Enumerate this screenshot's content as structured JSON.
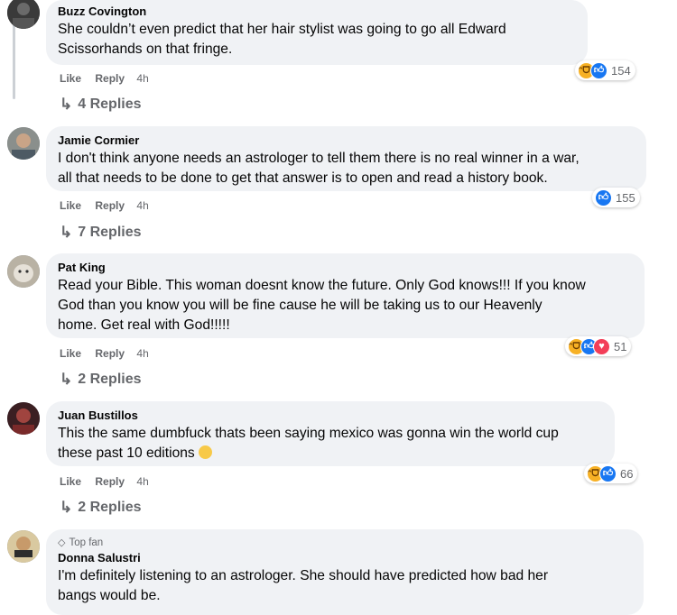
{
  "comments": [
    {
      "author": "Buzz Covington",
      "lines": [
        "She couldn’t even predict that her hair stylist was going to go all Edward",
        "Scissorhands on that fringe."
      ],
      "actions": {
        "like": "Like",
        "reply": "Reply",
        "time": "4h"
      },
      "reaction_count": "154",
      "replies_label": "4 Replies"
    },
    {
      "author": "Jamie Cormier",
      "lines": [
        "I don't think anyone needs an astrologer to tell them there is no real winner in a war,",
        "all that needs to be done to get that answer is to open and read a history book."
      ],
      "actions": {
        "like": "Like",
        "reply": "Reply",
        "time": "4h"
      },
      "reaction_count": "155",
      "replies_label": "7 Replies"
    },
    {
      "author": "Pat King",
      "lines": [
        "Read your Bible. This woman doesnt know the future. Only God knows!!! If you know",
        "God than you know you will be fine cause he will be taking us to our Heavenly",
        "home. Get real with God!!!!!"
      ],
      "actions": {
        "like": "Like",
        "reply": "Reply",
        "time": "4h"
      },
      "reaction_count": "51",
      "replies_label": "2 Replies"
    },
    {
      "author": "Juan Bustillos",
      "lines": [
        "This the same dumbfuck thats been saying mexico was gonna win the world cup",
        "these past 10 editions"
      ],
      "actions": {
        "like": "Like",
        "reply": "Reply",
        "time": "4h"
      },
      "reaction_count": "66",
      "replies_label": "2 Replies"
    },
    {
      "badge": "Top fan",
      "author": "Donna Salustri",
      "lines": [
        "I'm definitely listening to an astrologer. She should have predicted how bad her",
        "bangs would be."
      ]
    }
  ],
  "colors": {
    "bubble": "#f0f2f5",
    "meta": "#65676b",
    "like_blue": "#1877f2",
    "haha_yellow": "#f7b125",
    "love_red": "#f33e58"
  },
  "icons": {
    "reply_arrow": "reply-arrow-icon",
    "top_fan": "diamond-icon"
  }
}
